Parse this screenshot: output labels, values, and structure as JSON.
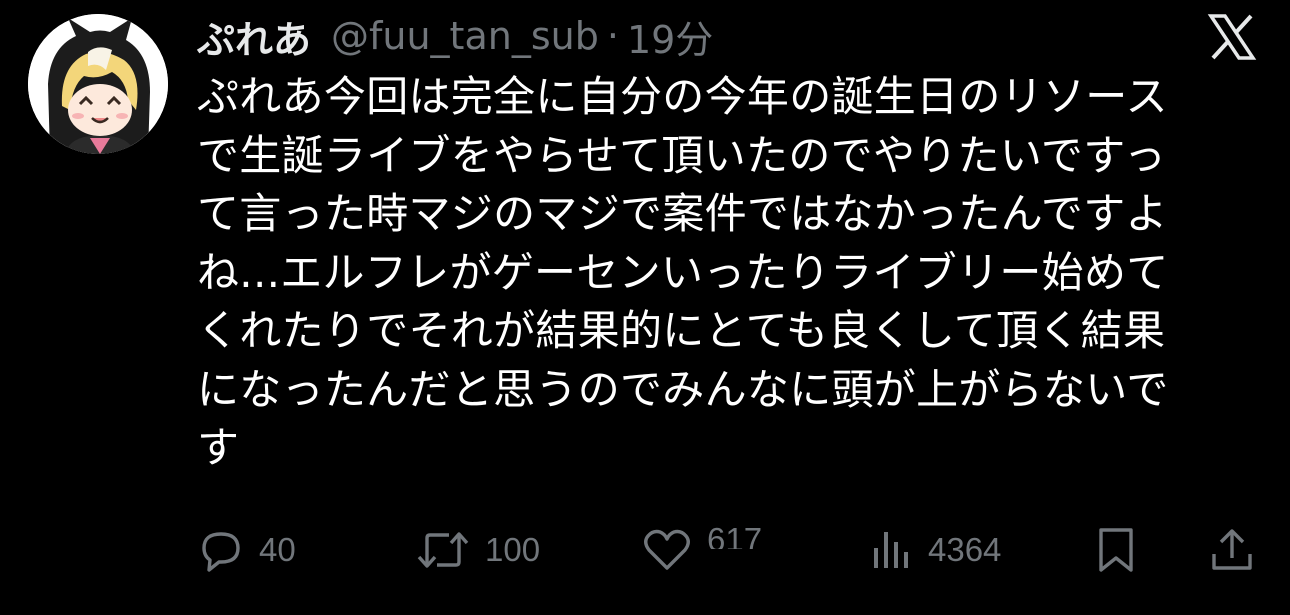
{
  "tweet": {
    "display_name": "ぷれあ",
    "handle": "@fuu_tan_sub",
    "separator": "·",
    "time": "19分",
    "text_lines": [
      "ぷれあ今回は完全に自分の今年の誕生日のリソース",
      "で生誕ライブをやらせて頂いたのでやりたいですっ",
      "て言った時マジのマジで案件ではなかったんですよ",
      "ね...エルフレがゲーセンいったりライブリー始めて",
      "くれたりでそれが結果的にとても良くして頂く結果",
      "になったんだと思うのでみんなに頭が上がらないで",
      "す"
    ]
  },
  "actions": {
    "reply_count": "40",
    "repost_count": "100",
    "like_count": "617",
    "views_count": "4364"
  },
  "icons": {
    "logo": "x-logo-icon",
    "reply": "reply-icon",
    "repost": "repost-icon",
    "like": "heart-icon",
    "views": "views-icon",
    "bookmark": "bookmark-icon",
    "share": "share-icon"
  },
  "colors": {
    "background": "#000000",
    "text": "#ffffff",
    "secondary": "#71767b"
  }
}
